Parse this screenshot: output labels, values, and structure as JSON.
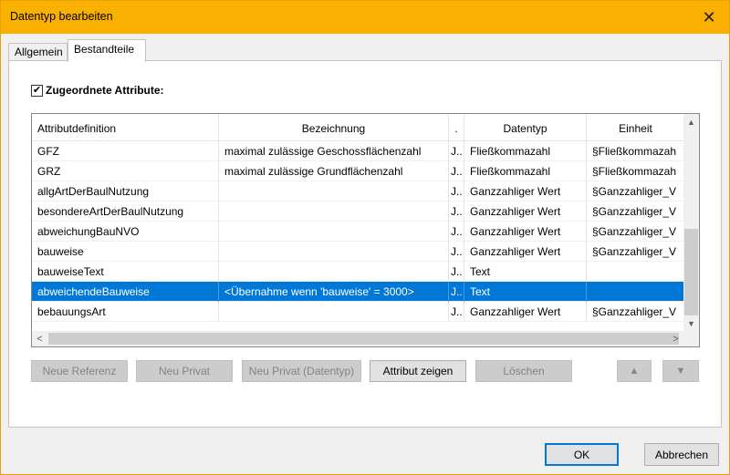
{
  "window": {
    "title": "Datentyp bearbeiten"
  },
  "tabs": [
    {
      "label": "Allgemein"
    },
    {
      "label": "Bestandteile"
    }
  ],
  "checkbox": {
    "label": "Zugeordnete Attribute:",
    "checked": true,
    "mark": "✔"
  },
  "table": {
    "headers": [
      "Attributdefinition",
      "Bezeichnung",
      ".",
      "Datentyp",
      "Einheit"
    ],
    "rows": [
      [
        "GFZ",
        "maximal zulässige Geschossflächenzahl",
        "J..",
        "Fließkommazahl",
        "§Fließkommazah"
      ],
      [
        "GRZ",
        "maximal zulässige Grundflächenzahl",
        "J..",
        "Fließkommazahl",
        "§Fließkommazah"
      ],
      [
        "allgArtDerBaulNutzung",
        "",
        "J..",
        "Ganzzahliger Wert",
        "§Ganzzahliger_V"
      ],
      [
        "besondereArtDerBaulNutzung",
        "",
        "J..",
        "Ganzzahliger Wert",
        "§Ganzzahliger_V"
      ],
      [
        "abweichungBauNVO",
        "",
        "J..",
        "Ganzzahliger Wert",
        "§Ganzzahliger_V"
      ],
      [
        "bauweise",
        "",
        "J..",
        "Ganzzahliger Wert",
        "§Ganzzahliger_V"
      ],
      [
        "bauweiseText",
        "",
        "J..",
        "Text",
        ""
      ],
      [
        "abweichendeBauweise",
        "<Übernahme wenn 'bauweise' = 3000>",
        "J..",
        "Text",
        ""
      ],
      [
        "bebauungsArt",
        "",
        "J..",
        "Ganzzahliger Wert",
        "§Ganzzahliger_V"
      ]
    ],
    "selected_row_index": 7
  },
  "scrollbar_icons": {
    "up": "▲",
    "down": "▼",
    "left": "<",
    "right": ">"
  },
  "buttons": {
    "neue_referenz": "Neue Referenz",
    "neu_privat": "Neu Privat",
    "neu_privat_datentyp": "Neu Privat (Datentyp)",
    "attribut_zeigen": "Attribut zeigen",
    "loeschen": "Löschen",
    "move_up": "▲",
    "move_down": "▼",
    "ok": "OK",
    "abbrechen": "Abbrechen"
  },
  "colors": {
    "titlebar": "#f9b000",
    "selection": "#0078d7",
    "default_button_border": "#0078d7"
  }
}
